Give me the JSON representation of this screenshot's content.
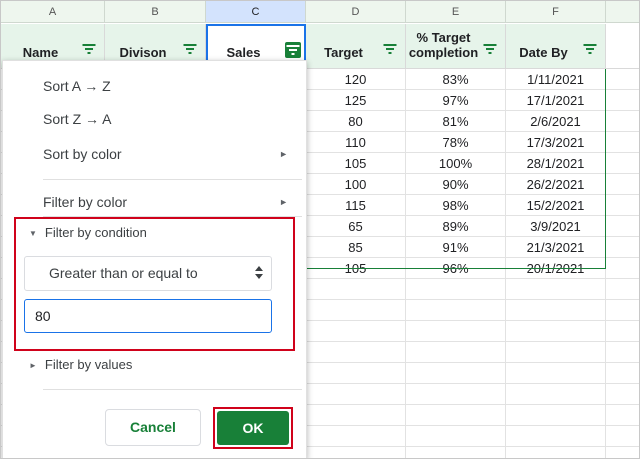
{
  "columns": [
    "A",
    "B",
    "C",
    "D",
    "E",
    "F"
  ],
  "headers": [
    {
      "label": "Name",
      "has_filter": true
    },
    {
      "label": "Divison",
      "has_filter": true
    },
    {
      "label": "Sales",
      "has_filter": true,
      "filter_active": true
    },
    {
      "label": "Target",
      "has_filter": true
    },
    {
      "label": "% Target completion",
      "line1": "% Target",
      "line2": "completion",
      "has_filter": true
    },
    {
      "label": "Date By",
      "has_filter": true
    }
  ],
  "rows": [
    [
      "120",
      "83%",
      "1/11/2021"
    ],
    [
      "125",
      "97%",
      "17/1/2021"
    ],
    [
      "80",
      "81%",
      "2/6/2021"
    ],
    [
      "110",
      "78%",
      "17/3/2021"
    ],
    [
      "105",
      "100%",
      "28/1/2021"
    ],
    [
      "100",
      "90%",
      "26/2/2021"
    ],
    [
      "115",
      "98%",
      "15/2/2021"
    ],
    [
      "65",
      "89%",
      "3/9/2021"
    ],
    [
      "85",
      "91%",
      "21/3/2021"
    ],
    [
      "105",
      "96%",
      "20/1/2021"
    ]
  ],
  "menu": {
    "sort_az": "Sort A → Z",
    "sort_za": "Sort Z → A",
    "sort_by_color": "Sort by color",
    "filter_by_color": "Filter by color",
    "filter_by_condition": "Filter by condition",
    "condition_value": "Greater than or equal to",
    "input_value": "80",
    "filter_by_values": "Filter by values",
    "cancel": "Cancel",
    "ok": "OK"
  },
  "colors": {
    "accent_green": "#188038",
    "header_green": "#e6f4ea",
    "highlight_red": "#d0021b",
    "selection_blue": "#1a73e8"
  }
}
